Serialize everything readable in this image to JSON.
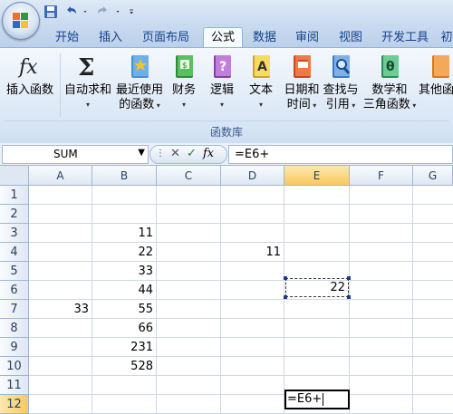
{
  "quick_access": {
    "icons": [
      "save-icon",
      "undo-icon",
      "redo-icon",
      "customize-icon"
    ]
  },
  "tabs": [
    "开始",
    "插入",
    "页面布局",
    "公式",
    "数据",
    "审阅",
    "视图",
    "开发工具",
    "初"
  ],
  "active_tab": "公式",
  "ribbon": {
    "buttons": [
      {
        "label": "插入函数",
        "sub": ""
      },
      {
        "label": "自动求和",
        "sub": ""
      },
      {
        "label": "最近使用",
        "sub": "的函数"
      },
      {
        "label": "财务",
        "sub": ""
      },
      {
        "label": "逻辑",
        "sub": ""
      },
      {
        "label": "文本",
        "sub": ""
      },
      {
        "label": "日期和",
        "sub": "时间"
      },
      {
        "label": "查找与",
        "sub": "引用"
      },
      {
        "label": "数学和",
        "sub": "三角函数"
      },
      {
        "label": "其他函",
        "sub": ""
      }
    ],
    "group_label": "函数库"
  },
  "formula_bar": {
    "name_box": "SUM",
    "formula": "=E6+"
  },
  "grid": {
    "columns": [
      "A",
      "B",
      "C",
      "D",
      "E",
      "F",
      "G"
    ],
    "rows": [
      "1",
      "2",
      "3",
      "4",
      "5",
      "6",
      "7",
      "8",
      "9",
      "10",
      "11",
      "12"
    ],
    "cells": {
      "B3": "11",
      "B4": "22",
      "B5": "33",
      "B6": "44",
      "B7": "55",
      "B8": "66",
      "B9": "231",
      "B10": "528",
      "A7": "33",
      "D4": "11",
      "E6": "22"
    },
    "edit_cell_text": "=E6+"
  },
  "colors": {
    "tab_text": "#15428b",
    "selected_header": "#f8c95c",
    "gridline": "#d0d7e5"
  }
}
